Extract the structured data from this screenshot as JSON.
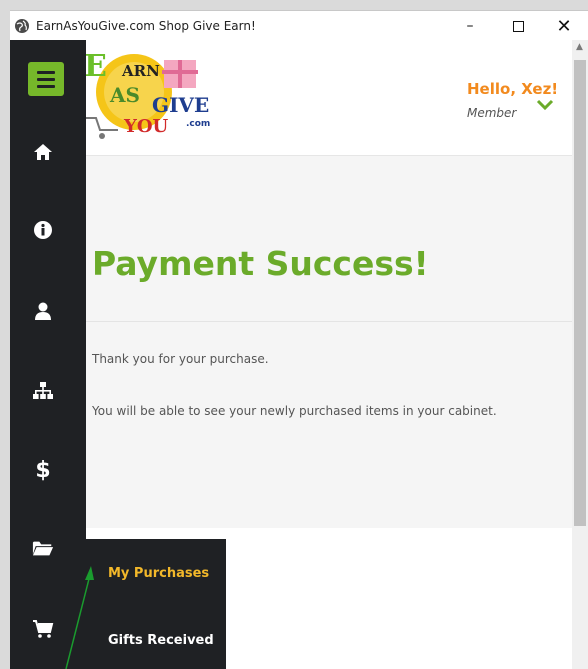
{
  "window": {
    "title": "EarnAsYouGive.com Shop Give Earn!",
    "minimize_glyph": "–",
    "close_glyph": "✕"
  },
  "header": {
    "greeting": "Hello, Xez!",
    "role": "Member",
    "logo_text": [
      "E",
      "ARN",
      "AS",
      "GIVE",
      "YOU",
      ".com"
    ]
  },
  "main": {
    "heading": "Payment Success!",
    "paragraphs": [
      "Thank you for your purchase.",
      "You will be able to see your newly purchased items in your cabinet."
    ]
  },
  "sidebar": {
    "icons": [
      "menu-icon",
      "home-icon",
      "info-icon",
      "user-icon",
      "sitemap-icon",
      "dollar-icon",
      "folder-open-icon",
      "cart-icon"
    ],
    "dollar_glyph": "$"
  },
  "submenu": {
    "items": [
      {
        "label": "My Purchases",
        "active": true
      },
      {
        "label": "Gifts Received",
        "active": false
      }
    ]
  },
  "colors": {
    "accent_green": "#76b82a",
    "heading_green": "#6bab2a",
    "greeting_orange": "#f28a1e",
    "active_submenu": "#f2b82a",
    "sidebar_bg": "#1f2124"
  }
}
